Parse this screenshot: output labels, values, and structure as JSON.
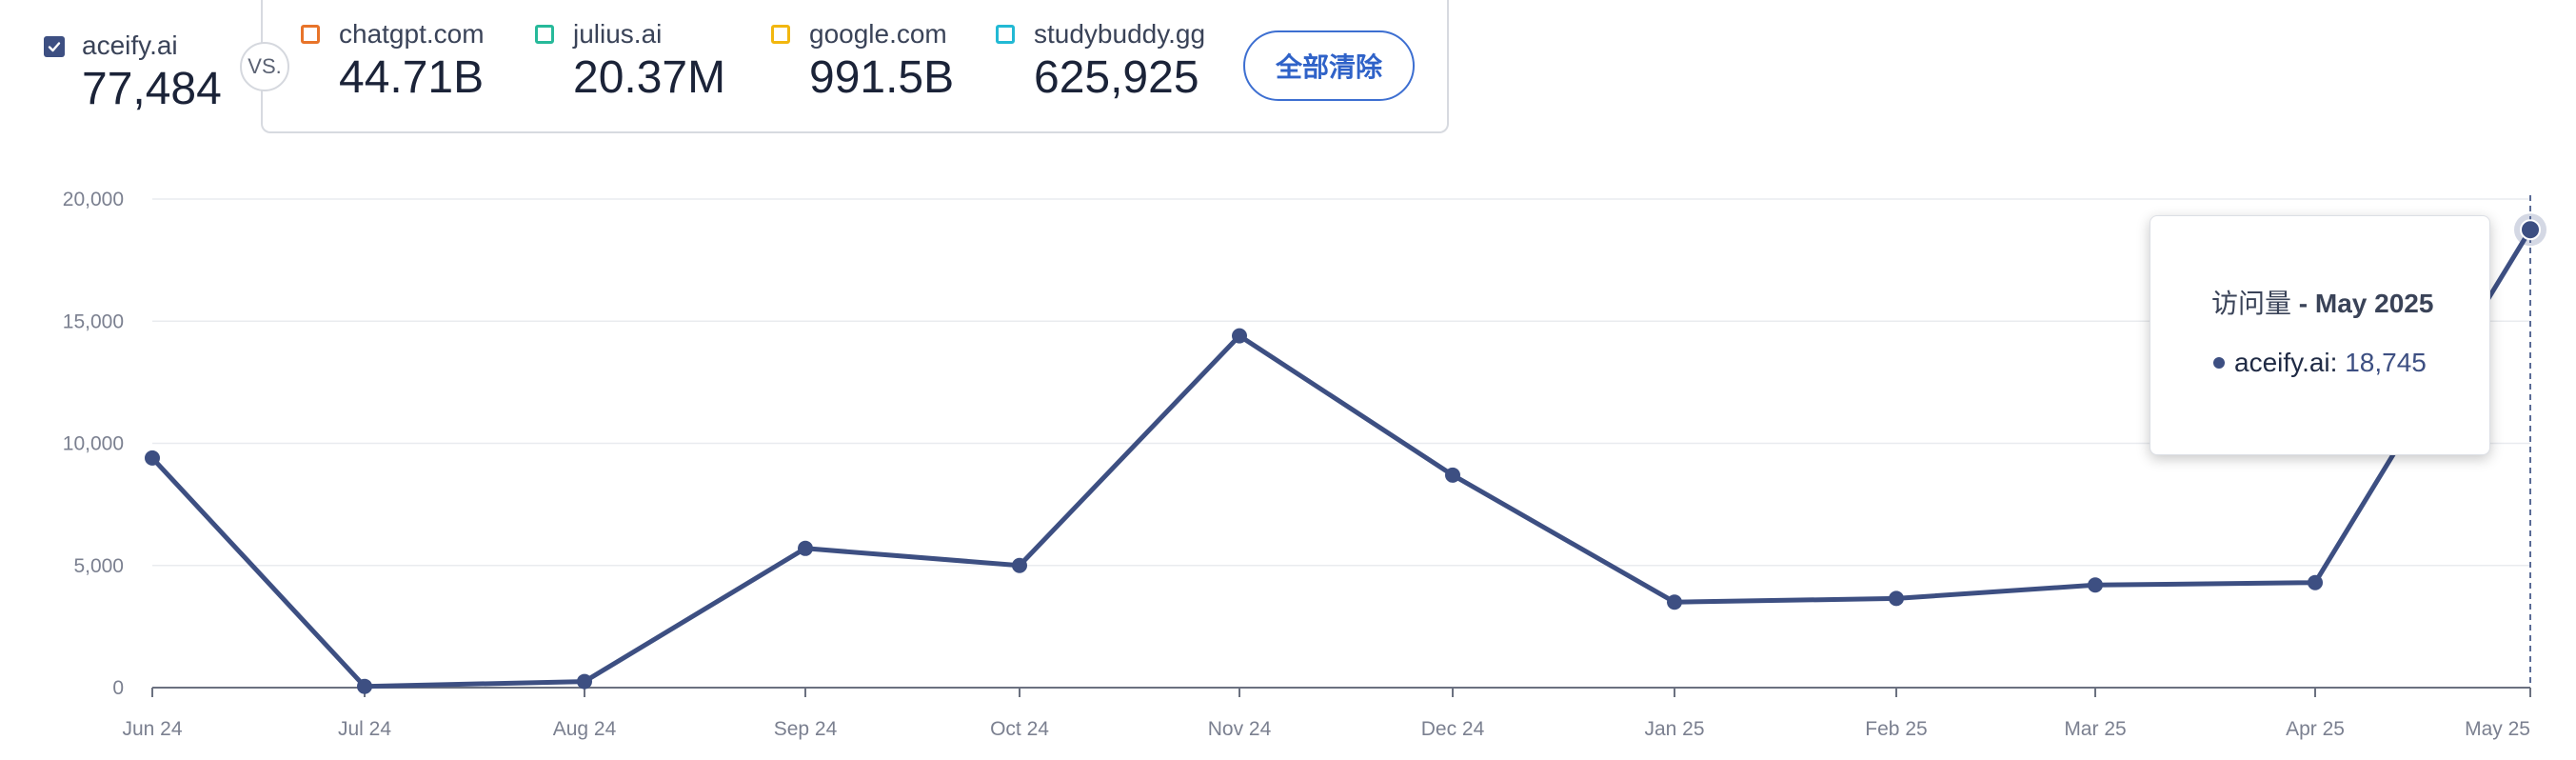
{
  "header": {
    "primary": {
      "name": "aceify.ai",
      "value": "77,484",
      "checked": true
    },
    "vs_label": "VS.",
    "comparisons": [
      {
        "name": "chatgpt.com",
        "value": "44.71B",
        "color": "#e8742a"
      },
      {
        "name": "julius.ai",
        "value": "20.37M",
        "color": "#27b99a"
      },
      {
        "name": "google.com",
        "value": "991.5B",
        "color": "#f2b70f"
      },
      {
        "name": "studybuddy.gg",
        "value": "625,925",
        "color": "#22b9d4"
      }
    ],
    "clear_all_label": "全部清除"
  },
  "chart_data": {
    "type": "line",
    "categories": [
      "Jun 24",
      "Jul 24",
      "Aug 24",
      "Sep 24",
      "Oct 24",
      "Nov 24",
      "Dec 24",
      "Jan 25",
      "Feb 25",
      "Mar 25",
      "Apr 25",
      "May 25"
    ],
    "series": [
      {
        "name": "aceify.ai",
        "color": "#3d4f82",
        "values": [
          9400,
          50,
          250,
          5700,
          5000,
          14400,
          8700,
          3500,
          3650,
          4200,
          4300,
          18745
        ]
      }
    ],
    "yticks": [
      "0",
      "5,000",
      "10,000",
      "15,000",
      "20,000"
    ],
    "ylim": [
      0,
      20000
    ],
    "grid": true,
    "highlight_index": 11
  },
  "tooltip": {
    "title_prefix": "访问量",
    "title_month": "- May 2025",
    "series_label": "aceify.ai:",
    "series_value": "18,745"
  }
}
